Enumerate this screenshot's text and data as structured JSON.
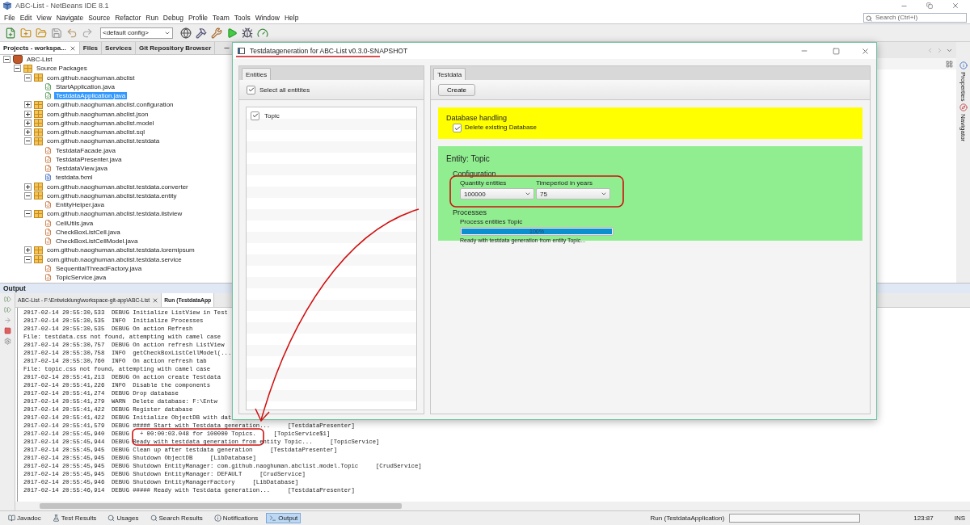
{
  "window": {
    "title": "ABC-List - NetBeans IDE 8.1"
  },
  "menu": [
    "File",
    "Edit",
    "View",
    "Navigate",
    "Source",
    "Refactor",
    "Run",
    "Debug",
    "Profile",
    "Team",
    "Tools",
    "Window",
    "Help"
  ],
  "search": {
    "placeholder": "Search (Ctrl+I)"
  },
  "toolbar": {
    "config": "<default config>"
  },
  "projects_panel": {
    "tabs": [
      {
        "label": "Projects - workspa...",
        "selected": true
      },
      {
        "label": "Files",
        "selected": false
      },
      {
        "label": "Services",
        "selected": false
      },
      {
        "label": "Git Repository Browser",
        "selected": false
      }
    ],
    "tree": [
      {
        "label": "ABC-List",
        "kind": "project",
        "expanded": true,
        "selected": false,
        "children": [
          {
            "label": "Source Packages",
            "kind": "folder",
            "expanded": true,
            "selected": false,
            "children": [
              {
                "label": "com.github.naoghuman.abclist",
                "kind": "package",
                "expanded": true,
                "selected": false,
                "children": [
                  {
                    "label": "StartApplication.java",
                    "kind": "main",
                    "selected": false
                  },
                  {
                    "label": "TestdataApplication.java",
                    "kind": "main",
                    "selected": true
                  }
                ]
              },
              {
                "label": "com.github.naoghuman.abclist.configuration",
                "kind": "package",
                "expanded": false,
                "selected": false
              },
              {
                "label": "com.github.naoghuman.abclist.json",
                "kind": "package",
                "expanded": false,
                "selected": false
              },
              {
                "label": "com.github.naoghuman.abclist.model",
                "kind": "package",
                "expanded": false,
                "selected": false
              },
              {
                "label": "com.github.naoghuman.abclist.sql",
                "kind": "package",
                "expanded": false,
                "selected": false
              },
              {
                "label": "com.github.naoghuman.abclist.testdata",
                "kind": "package",
                "expanded": true,
                "selected": false,
                "children": [
                  {
                    "label": "TestdataFacade.java",
                    "kind": "java",
                    "selected": false
                  },
                  {
                    "label": "TestdataPresenter.java",
                    "kind": "java",
                    "selected": false
                  },
                  {
                    "label": "TestdataView.java",
                    "kind": "java",
                    "selected": false
                  },
                  {
                    "label": "testdata.fxml",
                    "kind": "fxml",
                    "selected": false
                  }
                ]
              },
              {
                "label": "com.github.naoghuman.abclist.testdata.converter",
                "kind": "package",
                "expanded": false,
                "selected": false
              },
              {
                "label": "com.github.naoghuman.abclist.testdata.entity",
                "kind": "package",
                "expanded": true,
                "selected": false,
                "children": [
                  {
                    "label": "EntityHelper.java",
                    "kind": "java",
                    "selected": false
                  }
                ]
              },
              {
                "label": "com.github.naoghuman.abclist.testdata.listview",
                "kind": "package",
                "expanded": true,
                "selected": false,
                "children": [
                  {
                    "label": "CellUtils.java",
                    "kind": "java",
                    "selected": false
                  },
                  {
                    "label": "CheckBoxListCell.java",
                    "kind": "java",
                    "selected": false
                  },
                  {
                    "label": "CheckBoxListCellModel.java",
                    "kind": "java",
                    "selected": false
                  }
                ]
              },
              {
                "label": "com.github.naoghuman.abclist.testdata.loremipsum",
                "kind": "package",
                "expanded": false,
                "selected": false
              },
              {
                "label": "com.github.naoghuman.abclist.testdata.service",
                "kind": "package",
                "expanded": true,
                "selected": false,
                "children": [
                  {
                    "label": "SequentialThreadFactory.java",
                    "kind": "java",
                    "selected": false
                  },
                  {
                    "label": "TopicService.java",
                    "kind": "java",
                    "selected": false
                  }
                ]
              }
            ]
          }
        ]
      }
    ]
  },
  "side_strip": [
    "Properties",
    "Navigator"
  ],
  "output": {
    "title": "Output",
    "tabs": [
      {
        "label": "ABC-List - F:\\Entwicklung\\workspace-git-app\\ABC-List",
        "selected": false
      },
      {
        "label": "Run (TestdataApp",
        "selected": true
      }
    ],
    "lines": [
      "2017-02-14 20:55:30,533  DEBUG Initialize ListView in Test",
      "2017-02-14 20:55:30,535  INFO  Initialize Processes",
      "2017-02-14 20:55:30,535  DEBUG On action Refresh",
      "File: testdata.css not found, attempting with camel case",
      "2017-02-14 20:55:30,757  DEBUG On action refresh ListView",
      "2017-02-14 20:55:30,758  INFO  getCheckBoxListCellModel(...",
      "2017-02-14 20:55:30,760  INFO  On action refresh tab",
      "File: topic.css not found, attempting with camel case",
      "2017-02-14 20:55:41,213  DEBUG On action create Testdata",
      "2017-02-14 20:55:41,226  INFO  Disable the components",
      "2017-02-14 20:55:41,274  DEBUG Drop database",
      "2017-02-14 20:55:41,279  WARN  Delete database: F:\\Entw",
      "2017-02-14 20:55:41,422  DEBUG Register database",
      "2017-02-14 20:55:41,422  DEBUG Initialize ObjectDB with dat",
      "2017-02-14 20:55:41,579  DEBUG ##### Start with Testdata generation...     [TestdataPresenter]",
      "2017-02-14 20:55:45,940  DEBUG   + 00:00:03.048 for 100000 Topics.     [TopicService$1]",
      "2017-02-14 20:55:45,944  DEBUG Ready with testdata generation from entity Topic...     [TopicService]",
      "2017-02-14 20:55:45,945  DEBUG Clean up after testdata generation     [TestdataPresenter]",
      "2017-02-14 20:55:45,945  DEBUG Shutdown ObjectDB     [LibDatabase]",
      "2017-02-14 20:55:45,945  DEBUG Shutdown EntityManager: com.github.naoghuman.abclist.model.Topic     [CrudService]",
      "2017-02-14 20:55:45,945  DEBUG Shutdown EntityManager: DEFAULT     [CrudService]",
      "2017-02-14 20:55:45,946  DEBUG Shutdown EntityManagerFactory     [LibDatabase]",
      "2017-02-14 20:55:46,914  DEBUG ##### Ready with Testdata generation...     [TestdataPresenter]"
    ]
  },
  "status_bar": {
    "tabs": [
      {
        "label": "Javadoc",
        "kind": "javadoc",
        "selected": false
      },
      {
        "label": "Test Results",
        "kind": "tests",
        "selected": false
      },
      {
        "label": "Usages",
        "kind": "usages",
        "selected": false
      },
      {
        "label": "Search Results",
        "kind": "search",
        "selected": false
      },
      {
        "label": "Notifications",
        "kind": "info",
        "selected": false
      },
      {
        "label": "Output",
        "kind": "output",
        "selected": true
      }
    ],
    "task": "Run (TestdataApplication)",
    "task_progress": {
      "level": 0
    },
    "position": "123:87",
    "mode": "INS"
  },
  "dialog": {
    "title": "Testdatageneration for ABC-List v0.3.0-SNAPSHOT",
    "entities": {
      "tab": "Entities",
      "select_all": {
        "label": "Select all entitites",
        "checked": true
      },
      "items": [
        {
          "label": "Topic",
          "checked": true
        }
      ]
    },
    "testdata": {
      "tab": "Testdata",
      "create": "Create",
      "database": {
        "title": "Database handling",
        "delete": {
          "label": "Delete existing Database",
          "checked": true
        }
      },
      "entity": {
        "title": "Entity: Topic",
        "configuration": "Configuration",
        "fields": [
          {
            "label": "Quantity entities",
            "value": "100000"
          },
          {
            "label": "Timeperiod in years",
            "value": "75"
          }
        ],
        "processes": "Processes",
        "process": {
          "label": "Process entities Topic",
          "level": 1,
          "reading": "100%",
          "message": "Ready with testdata generation from entity Topic..."
        }
      }
    }
  }
}
